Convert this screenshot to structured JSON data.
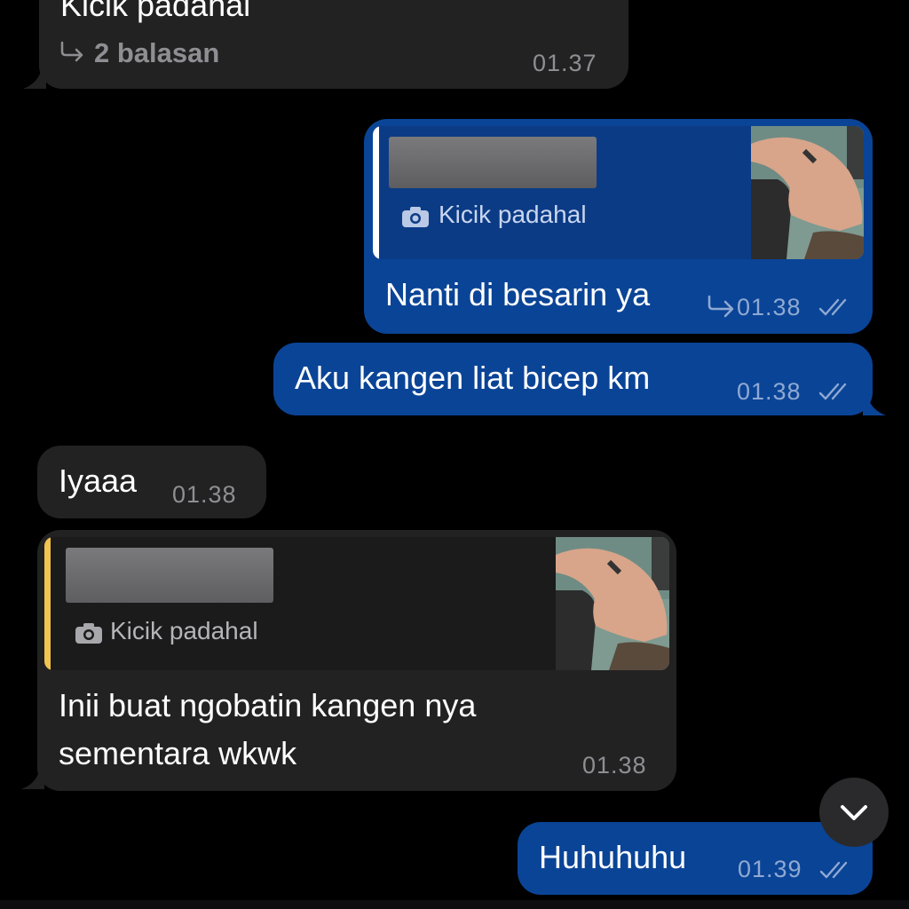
{
  "messages": {
    "m1": {
      "text": "Kicik padahal",
      "replies": "2 balasan",
      "time": "01.37"
    },
    "m2": {
      "quote_caption": "Kicik padahal",
      "text": "Nanti di besarin ya",
      "time": "01.38"
    },
    "m3": {
      "text": "Aku kangen liat bicep km",
      "time": "01.38"
    },
    "m4": {
      "text": "Iyaaa",
      "time": "01.38"
    },
    "m5": {
      "quote_caption": "Kicik padahal",
      "line1": "Inii buat ngobatin kangen nya",
      "line2": "sementara wkwk",
      "time": "01.38"
    },
    "m6": {
      "text": "Huhuhuhu",
      "time": "01.39"
    }
  },
  "colors": {
    "outgoing_bubble": "#0a4496",
    "incoming_bubble": "#222223",
    "quote_accent_yellow": "#f1c350",
    "background": "#000000"
  },
  "icons": {
    "reply_arrow": "reply-arrow-icon",
    "camera": "camera-icon",
    "read_ticks": "double-check-icon",
    "scroll_down": "chevron-down-icon"
  }
}
